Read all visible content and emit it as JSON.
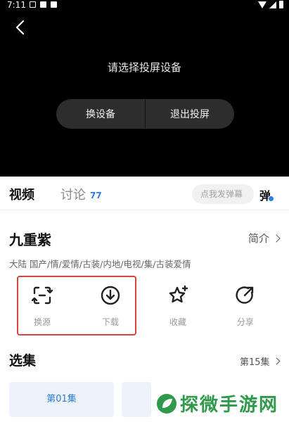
{
  "status_bar": {
    "time": "7:11"
  },
  "player": {
    "cast_prompt": "请选择投屏设备",
    "switch_device_label": "换设备",
    "exit_cast_label": "退出投屏"
  },
  "tabs": {
    "video": "视频",
    "discuss": "讨论",
    "discuss_count": "77",
    "danmu_placeholder": "点我发弹幕",
    "danmu_toggle": "弹"
  },
  "show": {
    "title": "九重紫",
    "intro_label": "简介",
    "tags": "大陆  国产/情/爱情/古装/内地/电视/集/古装爱情"
  },
  "actions": [
    {
      "label": "换源",
      "icon": "switch-source-icon"
    },
    {
      "label": "下载",
      "icon": "download-icon"
    },
    {
      "label": "收藏",
      "icon": "star-icon"
    },
    {
      "label": "分享",
      "icon": "share-icon"
    }
  ],
  "episodes": {
    "title": "选集",
    "count_label": "第15集",
    "items": [
      "第01集"
    ]
  },
  "watermark": {
    "text": "探微手游网"
  },
  "colors": {
    "accent": "#2a7de1",
    "highlight": "#d9443c",
    "watermark": "#2f9a4a"
  }
}
